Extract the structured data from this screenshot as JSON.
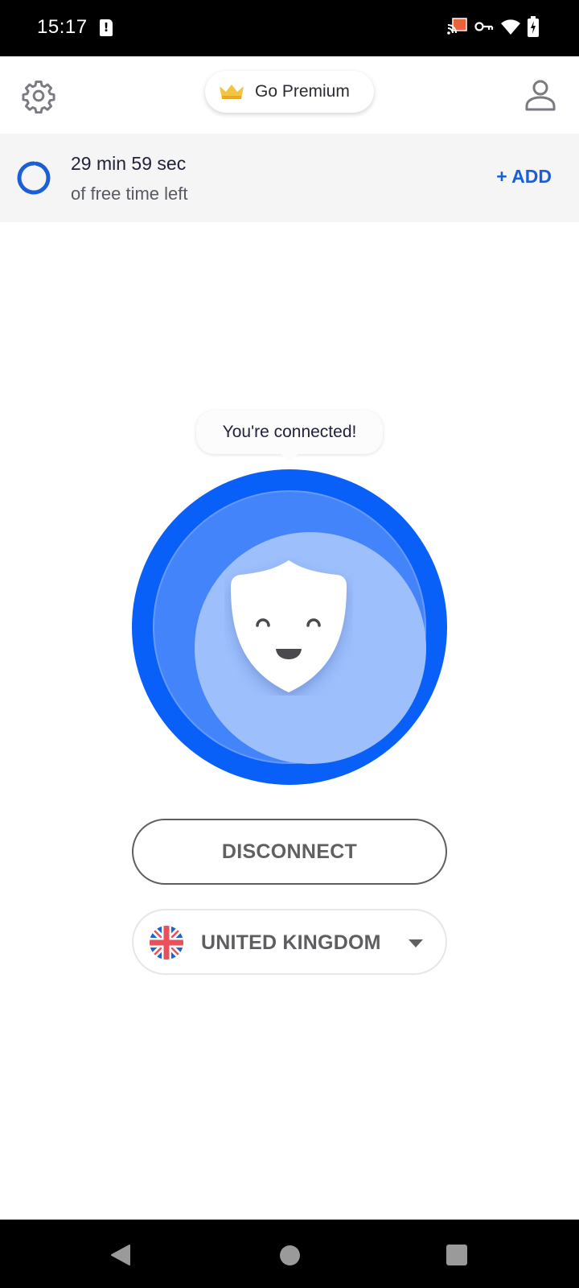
{
  "status_bar": {
    "time": "15:17",
    "icons": [
      "sim-alert-icon",
      "cast-icon",
      "vpn-key-icon",
      "wifi-icon",
      "battery-charging-icon"
    ],
    "cast_color": "#e8623c"
  },
  "header": {
    "settings_icon": "gear-icon",
    "premium_label": "Go Premium",
    "premium_icon": "crown-icon",
    "profile_icon": "user-icon"
  },
  "timer": {
    "time_left": "29 min 59 sec",
    "subtitle": "of free time left",
    "add_label": "+ ADD",
    "remaining_fraction": 0.97,
    "accent_color": "#1a5fd6"
  },
  "connection": {
    "tooltip": "You're connected!",
    "status": "connected",
    "mascot_icon": "smiling-shield-icon",
    "colors": {
      "outer": "#0860f9",
      "middle": "#4484fb",
      "inner": "#9dbffc"
    }
  },
  "actions": {
    "disconnect_label": "DISCONNECT",
    "country_selected": "UNITED KINGDOM",
    "country_flag_icon": "uk-flag-icon"
  },
  "nav_bar": {
    "back_icon": "back-triangle-icon",
    "home_icon": "home-circle-icon",
    "recents_icon": "recents-square-icon"
  }
}
